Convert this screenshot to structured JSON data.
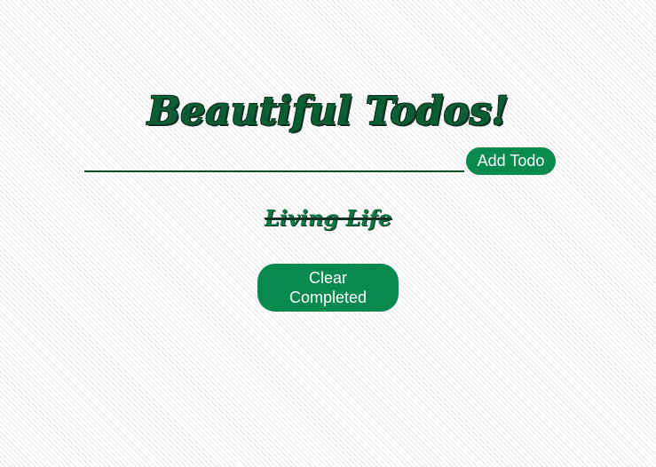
{
  "header": {
    "title": "Beautiful Todos!"
  },
  "input": {
    "value": "",
    "add_label": "Add Todo"
  },
  "todos": [
    {
      "text": "Living Life",
      "completed": true
    }
  ],
  "actions": {
    "clear_label": "Clear Completed"
  },
  "colors": {
    "accent": "#078a4e",
    "title": "#0b5e34",
    "outline": "#0f3320"
  }
}
